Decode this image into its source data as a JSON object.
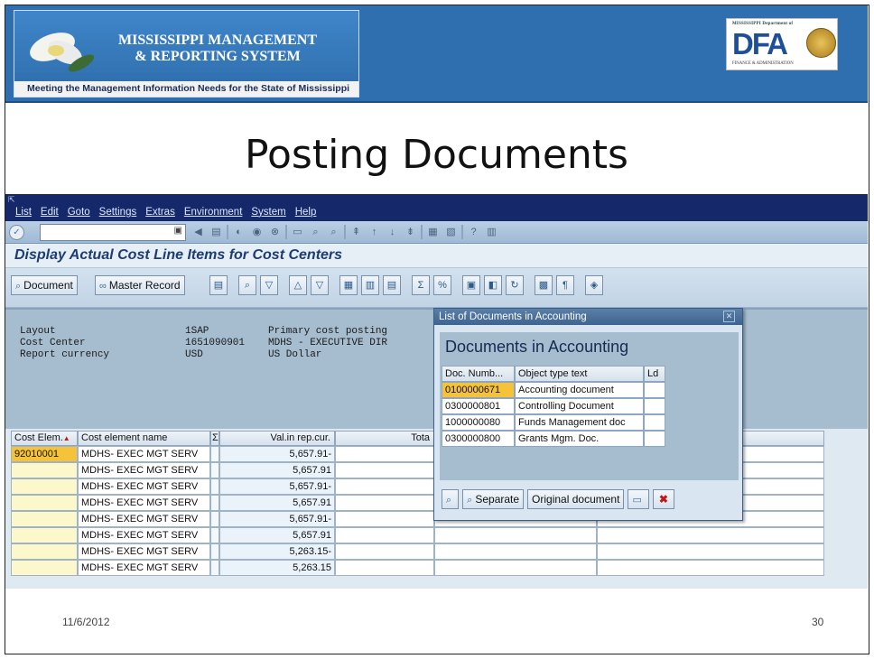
{
  "header": {
    "logo_line1": "MISSISSIPPI MANAGEMENT",
    "logo_line2": "& REPORTING SYSTEM",
    "logo_tagline": "Meeting the Management Information Needs for the State of Mississippi",
    "dfa_small": "MISSISSIPPI Department of",
    "dfa_letters": "DFA",
    "dfa_finance": "FINANCE & ADMINISTRATION"
  },
  "slide_title": "Posting Documents",
  "sap": {
    "menu": [
      "List",
      "Edit",
      "Goto",
      "Settings",
      "Extras",
      "Environment",
      "System",
      "Help"
    ],
    "command_field_value": "",
    "screen_title": "Display Actual Cost Line Items for Cost Centers",
    "buttons": {
      "document": "Document",
      "master_record": "Master Record"
    },
    "header_info": [
      {
        "label": "Layout",
        "code": "1SAP",
        "desc": "Primary cost posting"
      },
      {
        "label": "Cost Center",
        "code": "1651090901",
        "desc": "MDHS - EXECUTIVE DIR"
      },
      {
        "label": "Report currency",
        "code": "USD",
        "desc": "US Dollar"
      }
    ],
    "grid": {
      "headers": [
        "Cost Elem.",
        "Cost element name",
        "Σ",
        "Val.in rep.cur.",
        "Tota"
      ],
      "rows": [
        {
          "elem": "92010001",
          "name": "MDHS- EXEC MGT SERV",
          "value": "5,657.91-"
        },
        {
          "elem": "",
          "name": "MDHS- EXEC MGT SERV",
          "value": "5,657.91"
        },
        {
          "elem": "",
          "name": "MDHS- EXEC MGT SERV",
          "value": "5,657.91-"
        },
        {
          "elem": "",
          "name": "MDHS- EXEC MGT SERV",
          "value": "5,657.91"
        },
        {
          "elem": "",
          "name": "MDHS- EXEC MGT SERV",
          "value": "5,657.91-"
        },
        {
          "elem": "",
          "name": "MDHS- EXEC MGT SERV",
          "value": "5,657.91"
        },
        {
          "elem": "",
          "name": "MDHS- EXEC MGT SERV",
          "value": "5,263.15-"
        },
        {
          "elem": "",
          "name": "MDHS- EXEC MGT SERV",
          "value": "5,263.15"
        }
      ]
    }
  },
  "popup": {
    "title": "List of Documents in Accounting",
    "heading": "Documents in Accounting",
    "columns": [
      "Doc. Numb...",
      "Object type text",
      "Ld"
    ],
    "rows": [
      {
        "doc": "0100000671",
        "type": "Accounting document"
      },
      {
        "doc": "0300000801",
        "type": "Controlling Document"
      },
      {
        "doc": "1000000080",
        "type": "Funds Management doc"
      },
      {
        "doc": "0300000800",
        "type": "Grants Mgm. Doc."
      }
    ],
    "buttons": {
      "separate": "Separate",
      "original": "Original document"
    }
  },
  "footer": {
    "date": "11/6/2012",
    "page": "30"
  }
}
